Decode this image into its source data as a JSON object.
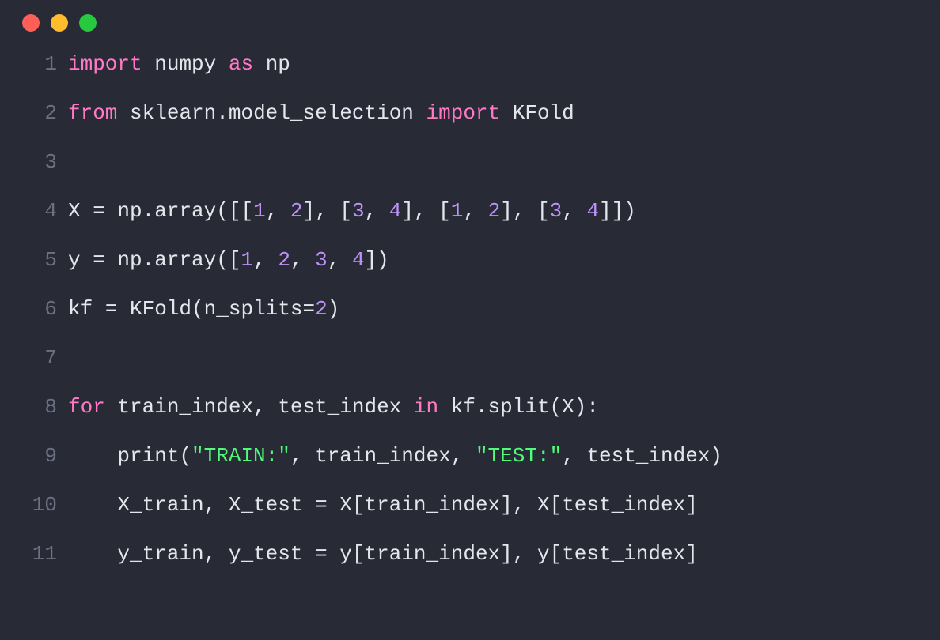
{
  "window_controls": [
    "close",
    "minimize",
    "zoom"
  ],
  "code_lines": [
    {
      "n": 1,
      "tokens": [
        {
          "t": "import",
          "c": "kw"
        },
        {
          "t": " ",
          "c": "punc"
        },
        {
          "t": "numpy",
          "c": "mod"
        },
        {
          "t": " ",
          "c": "punc"
        },
        {
          "t": "as",
          "c": "kw"
        },
        {
          "t": " ",
          "c": "punc"
        },
        {
          "t": "np",
          "c": "mod"
        }
      ]
    },
    {
      "n": 2,
      "tokens": [
        {
          "t": "from",
          "c": "kw"
        },
        {
          "t": " ",
          "c": "punc"
        },
        {
          "t": "sklearn",
          "c": "mod"
        },
        {
          "t": ".",
          "c": "punc"
        },
        {
          "t": "model_selection",
          "c": "mod"
        },
        {
          "t": " ",
          "c": "punc"
        },
        {
          "t": "import",
          "c": "kw"
        },
        {
          "t": " ",
          "c": "punc"
        },
        {
          "t": "KFold",
          "c": "mod"
        }
      ]
    },
    {
      "n": 3,
      "tokens": []
    },
    {
      "n": 4,
      "tokens": [
        {
          "t": "X ",
          "c": "mod"
        },
        {
          "t": "=",
          "c": "punc"
        },
        {
          "t": " np",
          "c": "mod"
        },
        {
          "t": ".",
          "c": "punc"
        },
        {
          "t": "array",
          "c": "fn"
        },
        {
          "t": "([[",
          "c": "punc"
        },
        {
          "t": "1",
          "c": "num"
        },
        {
          "t": ", ",
          "c": "punc"
        },
        {
          "t": "2",
          "c": "num"
        },
        {
          "t": "], [",
          "c": "punc"
        },
        {
          "t": "3",
          "c": "num"
        },
        {
          "t": ", ",
          "c": "punc"
        },
        {
          "t": "4",
          "c": "num"
        },
        {
          "t": "], [",
          "c": "punc"
        },
        {
          "t": "1",
          "c": "num"
        },
        {
          "t": ", ",
          "c": "punc"
        },
        {
          "t": "2",
          "c": "num"
        },
        {
          "t": "], [",
          "c": "punc"
        },
        {
          "t": "3",
          "c": "num"
        },
        {
          "t": ", ",
          "c": "punc"
        },
        {
          "t": "4",
          "c": "num"
        },
        {
          "t": "]])",
          "c": "punc"
        }
      ]
    },
    {
      "n": 5,
      "tokens": [
        {
          "t": "y ",
          "c": "mod"
        },
        {
          "t": "=",
          "c": "punc"
        },
        {
          "t": " np",
          "c": "mod"
        },
        {
          "t": ".",
          "c": "punc"
        },
        {
          "t": "array",
          "c": "fn"
        },
        {
          "t": "([",
          "c": "punc"
        },
        {
          "t": "1",
          "c": "num"
        },
        {
          "t": ", ",
          "c": "punc"
        },
        {
          "t": "2",
          "c": "num"
        },
        {
          "t": ", ",
          "c": "punc"
        },
        {
          "t": "3",
          "c": "num"
        },
        {
          "t": ", ",
          "c": "punc"
        },
        {
          "t": "4",
          "c": "num"
        },
        {
          "t": "])",
          "c": "punc"
        }
      ]
    },
    {
      "n": 6,
      "tokens": [
        {
          "t": "kf ",
          "c": "mod"
        },
        {
          "t": "=",
          "c": "punc"
        },
        {
          "t": " KFold",
          "c": "fn"
        },
        {
          "t": "(",
          "c": "punc"
        },
        {
          "t": "n_splits",
          "c": "mod"
        },
        {
          "t": "=",
          "c": "punc"
        },
        {
          "t": "2",
          "c": "num"
        },
        {
          "t": ")",
          "c": "punc"
        }
      ]
    },
    {
      "n": 7,
      "tokens": []
    },
    {
      "n": 8,
      "tokens": [
        {
          "t": "for",
          "c": "kw"
        },
        {
          "t": " train_index",
          "c": "mod"
        },
        {
          "t": ",",
          "c": "punc"
        },
        {
          "t": " test_index ",
          "c": "mod"
        },
        {
          "t": "in",
          "c": "kw"
        },
        {
          "t": " kf",
          "c": "mod"
        },
        {
          "t": ".",
          "c": "punc"
        },
        {
          "t": "split",
          "c": "fn"
        },
        {
          "t": "(",
          "c": "punc"
        },
        {
          "t": "X",
          "c": "mod"
        },
        {
          "t": ")",
          "c": "punc"
        },
        {
          "t": ":",
          "c": "punc"
        }
      ]
    },
    {
      "n": 9,
      "tokens": [
        {
          "t": "    ",
          "c": "punc"
        },
        {
          "t": "print",
          "c": "fn"
        },
        {
          "t": "(",
          "c": "punc"
        },
        {
          "t": "\"TRAIN:\"",
          "c": "str"
        },
        {
          "t": ", ",
          "c": "punc"
        },
        {
          "t": "train_index",
          "c": "mod"
        },
        {
          "t": ", ",
          "c": "punc"
        },
        {
          "t": "\"TEST:\"",
          "c": "str"
        },
        {
          "t": ", ",
          "c": "punc"
        },
        {
          "t": "test_index",
          "c": "mod"
        },
        {
          "t": ")",
          "c": "punc"
        }
      ]
    },
    {
      "n": 10,
      "tokens": [
        {
          "t": "    ",
          "c": "punc"
        },
        {
          "t": "X_train",
          "c": "mod"
        },
        {
          "t": ", ",
          "c": "punc"
        },
        {
          "t": "X_test ",
          "c": "mod"
        },
        {
          "t": "=",
          "c": "punc"
        },
        {
          "t": " X",
          "c": "mod"
        },
        {
          "t": "[",
          "c": "punc"
        },
        {
          "t": "train_index",
          "c": "mod"
        },
        {
          "t": "], ",
          "c": "punc"
        },
        {
          "t": "X",
          "c": "mod"
        },
        {
          "t": "[",
          "c": "punc"
        },
        {
          "t": "test_index",
          "c": "mod"
        },
        {
          "t": "]",
          "c": "punc"
        }
      ]
    },
    {
      "n": 11,
      "tokens": [
        {
          "t": "    ",
          "c": "punc"
        },
        {
          "t": "y_train",
          "c": "mod"
        },
        {
          "t": ", ",
          "c": "punc"
        },
        {
          "t": "y_test ",
          "c": "mod"
        },
        {
          "t": "=",
          "c": "punc"
        },
        {
          "t": " y",
          "c": "mod"
        },
        {
          "t": "[",
          "c": "punc"
        },
        {
          "t": "train_index",
          "c": "mod"
        },
        {
          "t": "], ",
          "c": "punc"
        },
        {
          "t": "y",
          "c": "mod"
        },
        {
          "t": "[",
          "c": "punc"
        },
        {
          "t": "test_index",
          "c": "mod"
        },
        {
          "t": "]",
          "c": "punc"
        }
      ]
    }
  ]
}
